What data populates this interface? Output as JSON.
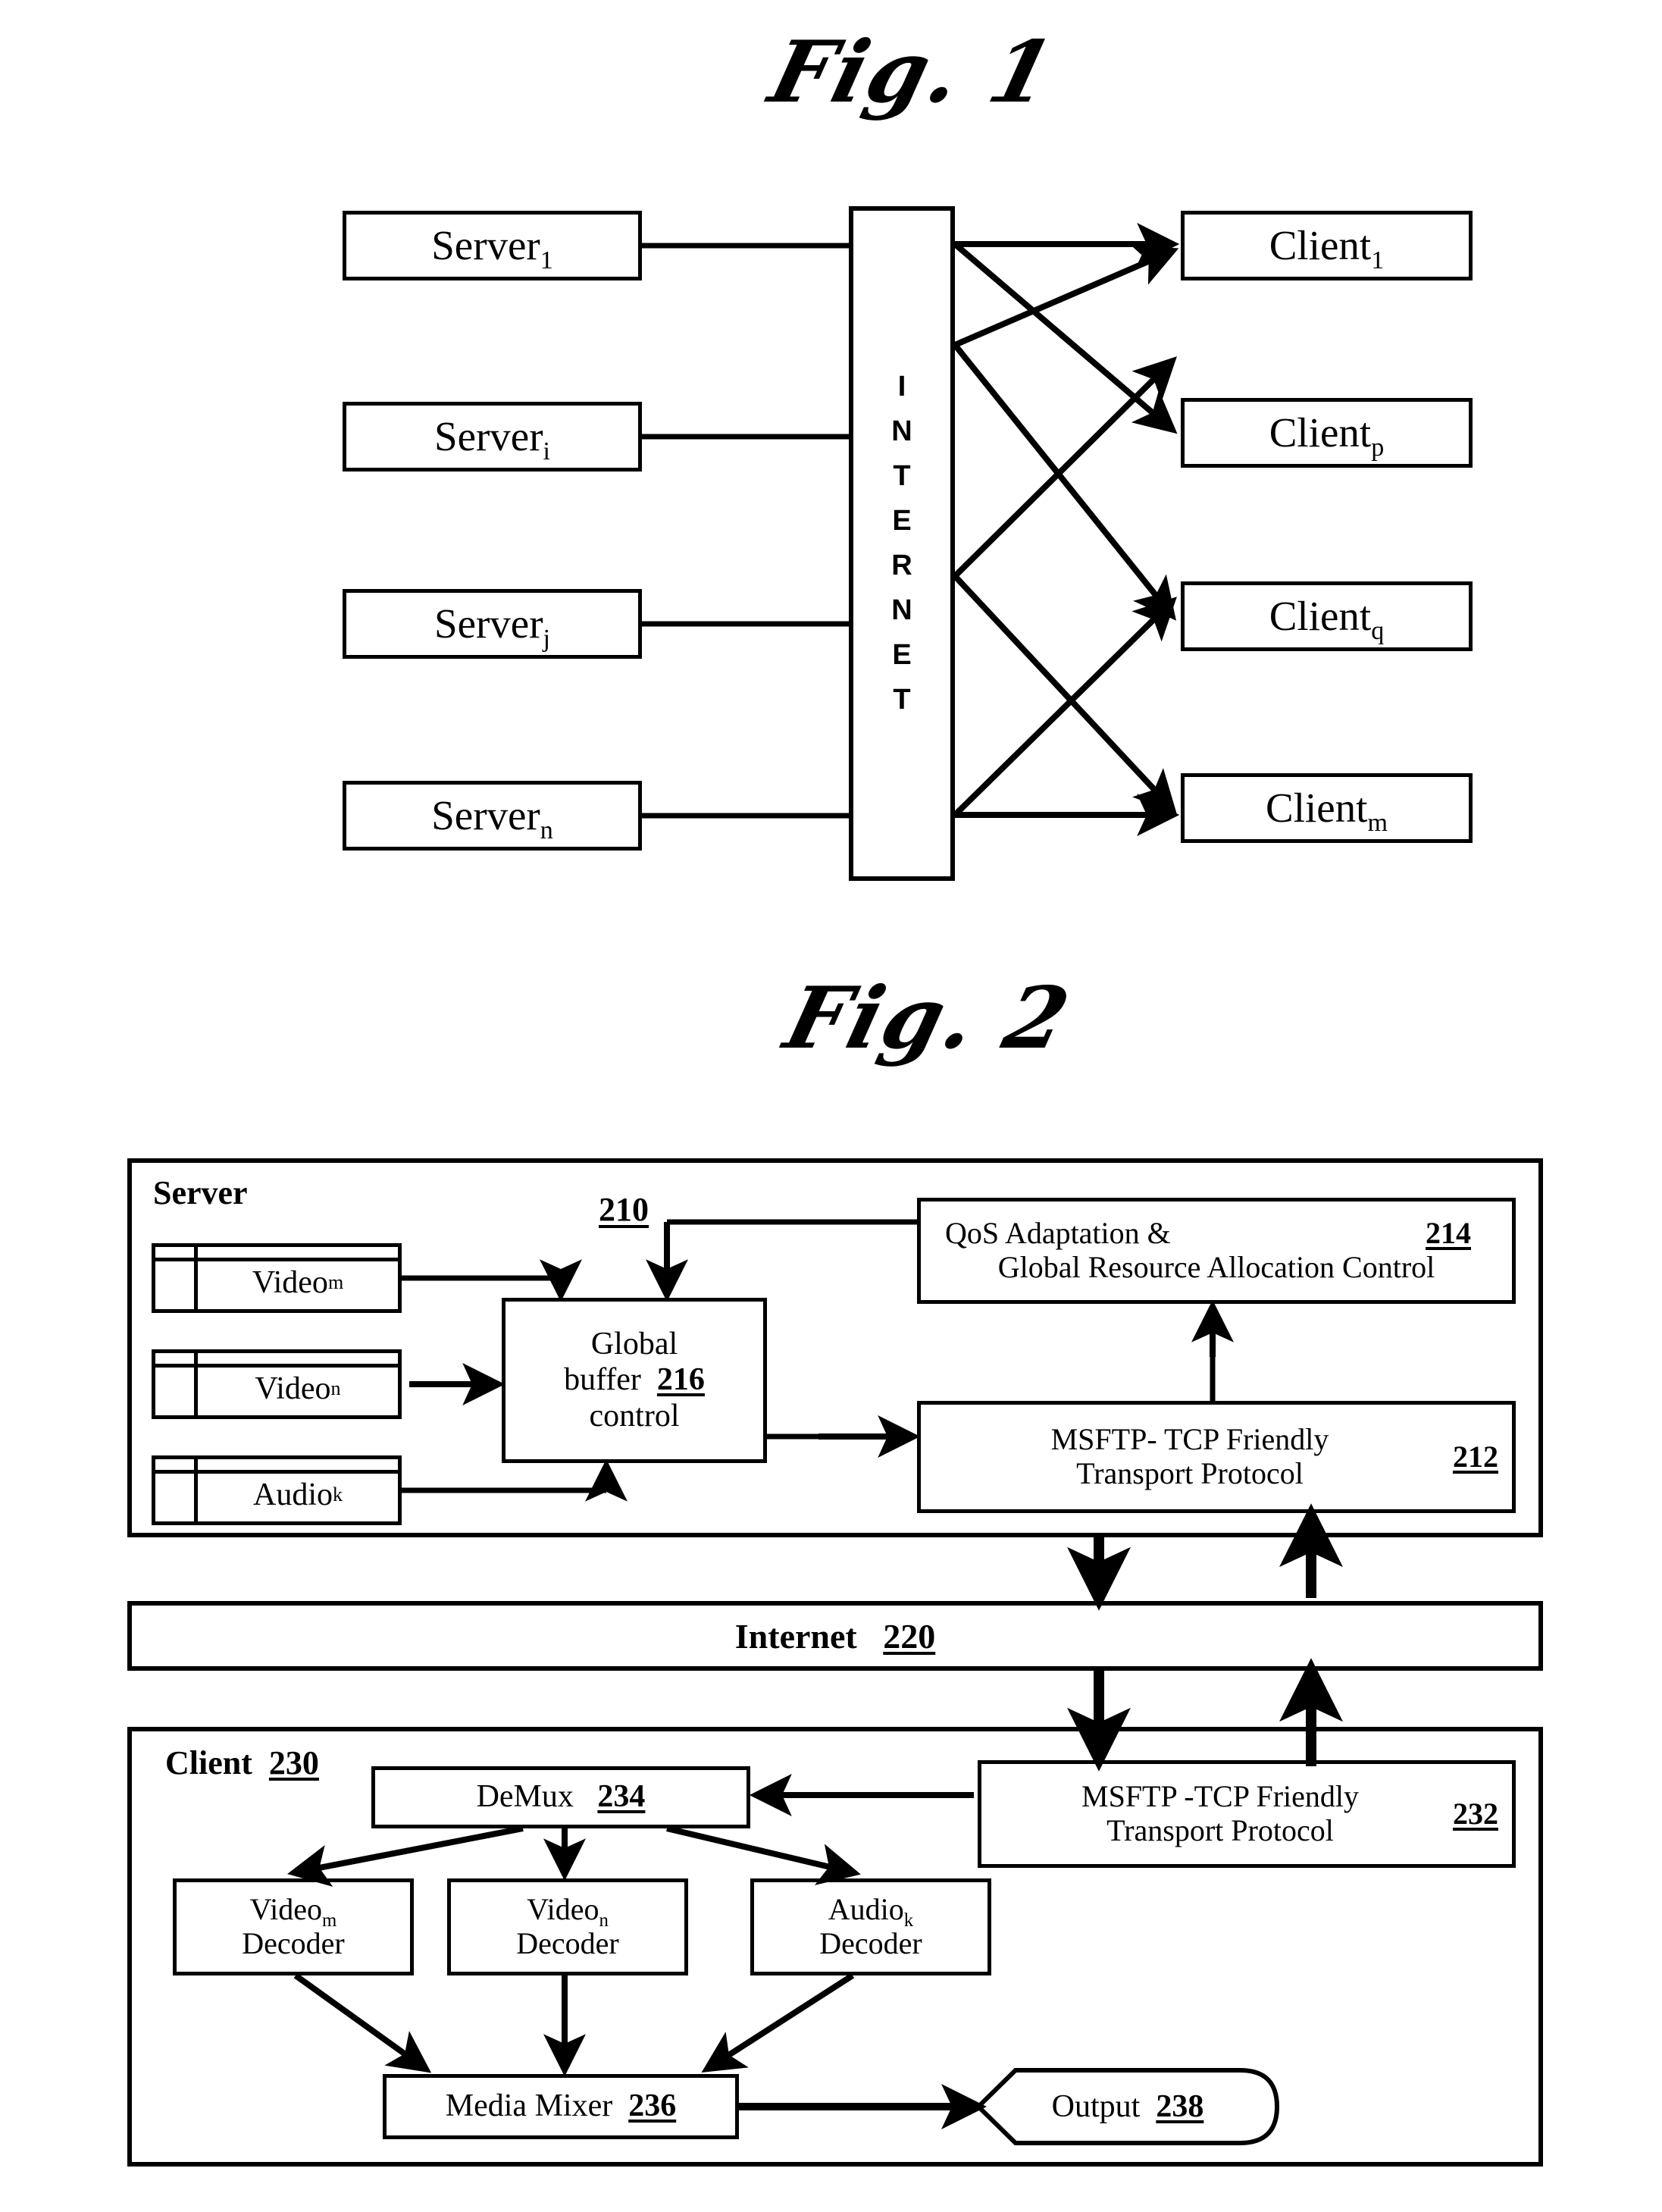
{
  "figures": [
    {
      "id": "fig1",
      "title": "Fig. 1",
      "servers": [
        {
          "base": "Server",
          "sub": "1"
        },
        {
          "base": "Server",
          "sub": "i"
        },
        {
          "base": "Server",
          "sub": "j"
        },
        {
          "base": "Server",
          "sub": "n"
        }
      ],
      "network": {
        "label": "INTERNET",
        "letters": [
          "I",
          "N",
          "T",
          "E",
          "R",
          "N",
          "E",
          "T"
        ]
      },
      "clients": [
        {
          "base": "Client",
          "sub": "1"
        },
        {
          "base": "Client",
          "sub": "p"
        },
        {
          "base": "Client",
          "sub": "q"
        },
        {
          "base": "Client",
          "sub": "m"
        }
      ]
    },
    {
      "id": "fig2",
      "title": "Fig. 2",
      "server_panel": {
        "label": "Server",
        "ref": "210",
        "sources": [
          {
            "base": "Video",
            "sub": "m"
          },
          {
            "base": "Video",
            "sub": "n"
          },
          {
            "base": "Audio",
            "sub": "k"
          }
        ],
        "global_buffer": {
          "line1": "Global",
          "line2": "buffer",
          "ref": "216",
          "line3": "control"
        },
        "qos": {
          "line1": "QoS Adaptation &",
          "line2": "Global Resource Allocation Control",
          "ref": "214"
        },
        "msftp": {
          "line1": "MSFTP- TCP Friendly",
          "line2": "Transport Protocol",
          "ref": "212"
        }
      },
      "internet_bar": {
        "label": "Internet",
        "ref": "220"
      },
      "client_panel": {
        "label": "Client",
        "ref": "230",
        "msftp": {
          "line1": "MSFTP -TCP Friendly",
          "line2": "Transport Protocol",
          "ref": "232"
        },
        "demux": {
          "label": "DeMux",
          "ref": "234"
        },
        "decoders": [
          {
            "base": "Video",
            "sub": "m",
            "line2": "Decoder"
          },
          {
            "base": "Video",
            "sub": "n",
            "line2": "Decoder"
          },
          {
            "base": "Audio",
            "sub": "k",
            "line2": "Decoder"
          }
        ],
        "mixer": {
          "label": "Media Mixer",
          "ref": "236"
        },
        "output": {
          "label": "Output",
          "ref": "238"
        }
      }
    }
  ]
}
